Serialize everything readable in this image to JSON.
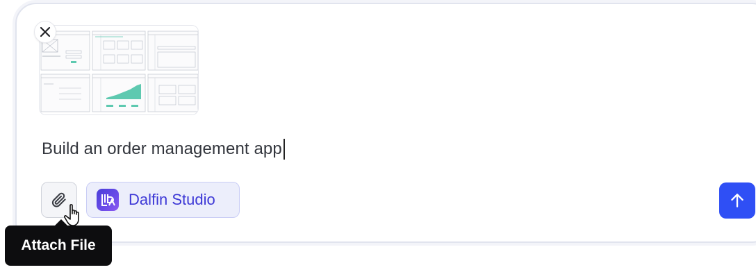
{
  "composer": {
    "prompt_text": "Build an order management app",
    "attachment": {
      "kind": "wireframe-image",
      "remove_icon": "close-icon"
    },
    "toolbar": {
      "attach_icon": "paperclip-icon",
      "attach_tooltip": "Attach File",
      "studio_chip": {
        "label": "Dalfin Studio",
        "icon": "dalfin-logo"
      },
      "send_icon": "arrow-up-icon"
    }
  },
  "colors": {
    "send_button": "#2f4ff5",
    "studio_chip_bg": "#eceefb",
    "studio_chip_text": "#3d38d6",
    "tooltip_bg": "#0d0d0f",
    "wireframe_accent": "#5ec9b0"
  }
}
